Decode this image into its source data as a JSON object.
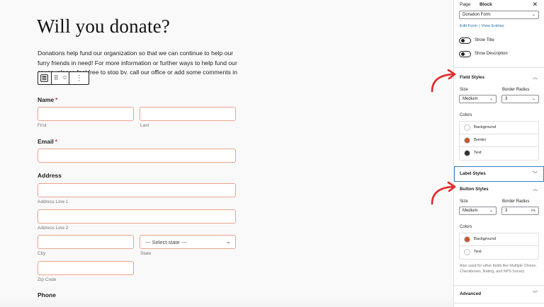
{
  "editor": {
    "title": "Will you donate?",
    "intro": "Donations help fund our organization so that we can continue to help our furry friends in need!  For more information or further ways to help fund our cause, please feel free to stop by, call our office or add some comments in",
    "toolbar": {
      "drag_glyph": "⠿",
      "up_glyph": "︿",
      "down_glyph": "﹀",
      "more_glyph": "⋮"
    },
    "fields": {
      "name_label": "Name",
      "name_required": "*",
      "first_sub": "First",
      "last_sub": "Last",
      "email_label": "Email",
      "email_required": "*",
      "address_label": "Address",
      "address1_sub": "Address Line 1",
      "address2_sub": "Address Line 2",
      "city_sub": "City",
      "state_placeholder": "--- Select state ---",
      "state_sub": "State",
      "zip_sub": "Zip Code",
      "phone_label": "Phone"
    }
  },
  "sidebar": {
    "tabs": {
      "page": "Page",
      "block": "Block"
    },
    "close_glyph": "✕",
    "form_select": "Donation Form",
    "edit_form": "Edit Form",
    "link_sep": "|",
    "view_entries": "View Entries",
    "show_title": "Show Title",
    "show_description": "Show Description",
    "field_styles": {
      "heading": "Field Styles",
      "size_label": "Size",
      "size_value": "Medium",
      "radius_label": "Border Radius",
      "radius_value": "3",
      "colors_label": "Colors",
      "colors": [
        {
          "label": "Background",
          "color": "#ffffff"
        },
        {
          "label": "Border",
          "color": "#c8552b"
        },
        {
          "label": "Text",
          "color": "#333333"
        }
      ]
    },
    "label_styles": {
      "heading": "Label Styles"
    },
    "button_styles": {
      "heading": "Button Styles",
      "size_label": "Size",
      "size_value": "Medium",
      "radius_label": "Border Radius",
      "radius_value": "3",
      "radius_unit": "PX",
      "colors_label": "Colors",
      "colors": [
        {
          "label": "Background",
          "color": "#c8552b"
        },
        {
          "label": "Text",
          "color": "#ffffff"
        }
      ],
      "note": "Also used for other fields like Multiple Choice, Checkboxes, Rating, and NPS Survey."
    },
    "advanced": {
      "heading": "Advanced"
    },
    "caret_up": "︿",
    "caret_down": "﹀",
    "select_caret": "⌄"
  },
  "colors": {
    "accent": "#3582c4",
    "link": "#2271b1",
    "field_border": "#e8a48a",
    "annotation_arrow": "#e02b2b"
  }
}
